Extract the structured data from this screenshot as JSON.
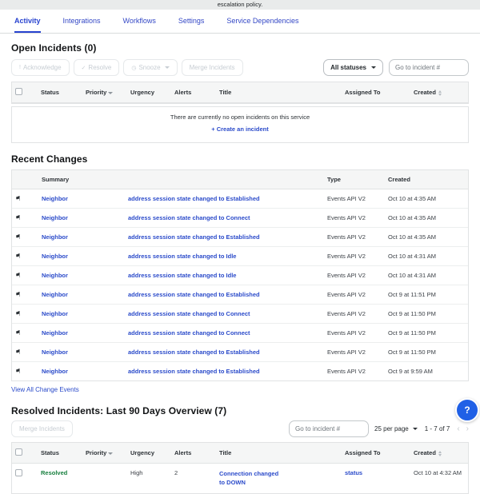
{
  "page": {
    "top_note": "escalation policy."
  },
  "tabs": [
    {
      "label": "Activity",
      "active": true
    },
    {
      "label": "Integrations"
    },
    {
      "label": "Workflows"
    },
    {
      "label": "Settings"
    },
    {
      "label": "Service Dependencies"
    }
  ],
  "open_incidents": {
    "title": "Open Incidents (0)",
    "actions": {
      "acknowledge": "Acknowledge",
      "resolve": "Resolve",
      "snooze": "Snooze",
      "merge": "Merge Incidents"
    },
    "icons": {
      "exclamation": "!",
      "check": "✓",
      "clock": "◷"
    },
    "all_statuses_label": "All statuses",
    "goto_placeholder": "Go to incident #",
    "columns": {
      "status": "Status",
      "priority": "Priority",
      "urgency": "Urgency",
      "alerts": "Alerts",
      "title": "Title",
      "assigned_to": "Assigned To",
      "created": "Created"
    },
    "empty": {
      "message": "There are currently no open incidents on this service",
      "create_link": "+ Create an incident"
    }
  },
  "recent_changes": {
    "title": "Recent Changes",
    "columns": {
      "summary": "Summary",
      "type": "Type",
      "created": "Created"
    },
    "rows": [
      {
        "actor": "Neighbor",
        "summary": "address session state changed to Established",
        "type": "Events API V2",
        "created": "Oct 10 at 4:35 AM"
      },
      {
        "actor": "Neighbor",
        "summary": "address session state changed to Connect",
        "type": "Events API V2",
        "created": "Oct 10 at 4:35 AM"
      },
      {
        "actor": "Neighbor",
        "summary": "address session state changed to Established",
        "type": "Events API V2",
        "created": "Oct 10 at 4:35 AM"
      },
      {
        "actor": "Neighbor",
        "summary": "address session state changed to Idle",
        "type": "Events API V2",
        "created": "Oct 10 at 4:31 AM"
      },
      {
        "actor": "Neighbor",
        "summary": "address session state changed to Idle",
        "type": "Events API V2",
        "created": "Oct 10 at 4:31 AM"
      },
      {
        "actor": "Neighbor",
        "summary": "address session state changed to Established",
        "type": "Events API V2",
        "created": "Oct 9 at 11:51 PM"
      },
      {
        "actor": "Neighbor",
        "summary": "address session state changed to Connect",
        "type": "Events API V2",
        "created": "Oct 9 at 11:50 PM"
      },
      {
        "actor": "Neighbor",
        "summary": "address session state changed to Connect",
        "type": "Events API V2",
        "created": "Oct 9 at 11:50 PM"
      },
      {
        "actor": "Neighbor",
        "summary": "address session state changed to Established",
        "type": "Events API V2",
        "created": "Oct 9 at 11:50 PM"
      },
      {
        "actor": "Neighbor",
        "summary": "address session state changed to Established",
        "type": "Events API V2",
        "created": "Oct 9 at 9:59 AM"
      }
    ],
    "view_all": "View All Change Events"
  },
  "resolved_incidents": {
    "title": "Resolved Incidents: Last 90 Days Overview (7)",
    "merge_label": "Merge Incidents",
    "goto_placeholder": "Go to incident #",
    "per_page": "25 per page",
    "range": "1 - 7 of 7",
    "chevron_left": "‹",
    "chevron_right": "›",
    "columns": {
      "status": "Status",
      "priority": "Priority",
      "urgency": "Urgency",
      "alerts": "Alerts",
      "title": "Title",
      "assigned_to": "Assigned To",
      "created": "Created"
    },
    "rows": [
      {
        "status": "Resolved",
        "priority": "",
        "urgency": "High",
        "alerts": "2",
        "title": "Connection changed to DOWN",
        "assigned_to": "status",
        "created": "Oct 10 at 4:32 AM"
      }
    ]
  },
  "help": {
    "label": "?"
  },
  "colors": {
    "link_blue": "#2b4bca",
    "resolved_green": "#177f3e",
    "help_blue": "#2060e6",
    "header_gray": "#f5f6f6"
  }
}
